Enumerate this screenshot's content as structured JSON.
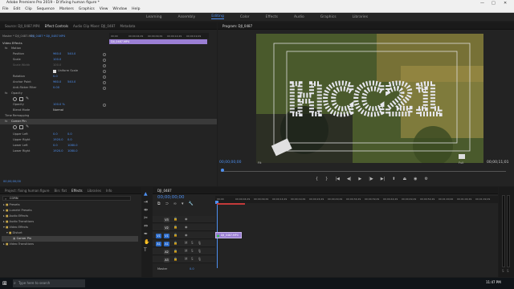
{
  "window": {
    "title": "Adobe Premiere Pro 2019 - D:\\fixing human figure *"
  },
  "menu": [
    "File",
    "Edit",
    "Clip",
    "Sequence",
    "Markers",
    "Graphics",
    "View",
    "Window",
    "Help"
  ],
  "workspaces": [
    "Learning",
    "Assembly",
    "Editing",
    "Color",
    "Effects",
    "Audio",
    "Graphics",
    "Libraries"
  ],
  "workspace_active": "Editing",
  "source_tabs": [
    "Source: DJI_0487.MP4",
    "Effect Controls",
    "Audio Clip Mixer: DJI_0487",
    "Metadata"
  ],
  "ec": {
    "master_label": "Master * DJI_0487.MP4",
    "sequence_label": "DJI_0487 * DJI_0487.MP4",
    "ruler": [
      "00;00",
      "00;00;04;29",
      "00;00;09;29",
      "00;00;14;29",
      "00;00;19;29"
    ],
    "clip_name": "DJI_0487.MP4",
    "video_effects": "Video Effects",
    "motion": "Motion",
    "position": {
      "label": "Position",
      "x": "960.0",
      "y": "540.0"
    },
    "scale": {
      "label": "Scale",
      "v": "100.0"
    },
    "scale_width": {
      "label": "Scale Width",
      "v": "100.0"
    },
    "uniform": "Uniform Scale",
    "rotation": {
      "label": "Rotation",
      "v": "0.0"
    },
    "anchor": {
      "label": "Anchor Point",
      "x": "960.0",
      "y": "540.0"
    },
    "antiflicker": {
      "label": "Anti-flicker Filter",
      "v": "0.00"
    },
    "opacity_group": "Opacity",
    "opacity": {
      "label": "Opacity",
      "v": "100.0 %"
    },
    "blend": {
      "label": "Blend Mode",
      "v": "Normal"
    },
    "time_remap": "Time Remapping",
    "corner_pin": "Corner Pin",
    "upper_left": {
      "label": "Upper Left",
      "x": "0.0",
      "y": "0.0"
    },
    "upper_right": {
      "label": "Upper Right",
      "x": "1920.0",
      "y": "0.0"
    },
    "lower_left": {
      "label": "Lower Left",
      "x": "0.0",
      "y": "1080.0"
    },
    "lower_right": {
      "label": "Lower Right",
      "x": "1920.0",
      "y": "1080.0"
    },
    "timecode": "00;00;00;00"
  },
  "program": {
    "tab": "Program: DJI_0487",
    "timecode_left": "00;00;00;00",
    "fit": "Fit",
    "quality": "Full",
    "timecode_right": "00;00;11;01",
    "aerial_text": "HCC21"
  },
  "project": {
    "tabs": [
      "Project: fixing human figure",
      "Bin: flat",
      "Effects",
      "Libraries",
      "Info"
    ],
    "search": "CORN",
    "items": [
      "Presets",
      "Lumetri Presets",
      "Audio Effects",
      "Audio Transitions",
      "Video Effects",
      "Distort",
      "Corner Pin",
      "Video Transitions"
    ]
  },
  "timeline": {
    "tab": "DJI_0487",
    "timecode": "00;00;00;00",
    "ruler": [
      "00;00",
      "00;00;04;29",
      "00;00;09;29",
      "00;00;14;29",
      "00;00;19;29",
      "00;00;24;29",
      "00;00;29;29",
      "00;00;34;29",
      "00;00;39;29",
      "00;00;44;29",
      "00;00;49;29",
      "00;00;54;29",
      "00;01;00;00",
      "00;01;04;29",
      "00;01;09;29"
    ],
    "tracks": [
      "V3",
      "V2",
      "V1",
      "A1",
      "A2",
      "A3"
    ],
    "v_prefix": "V1",
    "a_prefix": "A1",
    "master": "Master",
    "master_val": "0.0",
    "clip": "DJI_0487.MP4"
  },
  "taskbar": {
    "search": "Type here to search",
    "time": "11:47 PM"
  }
}
